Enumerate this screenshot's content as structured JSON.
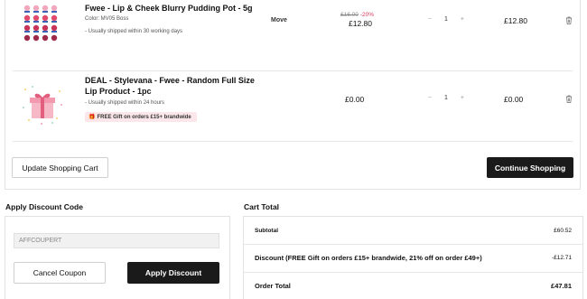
{
  "cart": {
    "items": [
      {
        "name": "Fwee - Lip & Cheek Blurry Pudding Pot - 5g",
        "color_line": "Color: MV05 Boss",
        "shipping": "- Usually shipped within 30 working days",
        "move_label": "Move",
        "price_original": "£16.00",
        "discount_pct": "-20%",
        "price": "£12.80",
        "qty_minus": "−",
        "qty": "1",
        "qty_plus": "+",
        "subtotal": "£12.80",
        "delete_icon": "trash-icon"
      },
      {
        "name": "DEAL - Stylevana - Fwee - Random Full Size Lip Product - 1pc",
        "shipping": "- Usually shipped within 24 hours",
        "gift_badge": "FREE Gift on orders £15+ brandwide",
        "price": "£0.00",
        "qty_minus": "−",
        "qty": "1",
        "qty_plus": "+",
        "subtotal": "£0.00",
        "delete_icon": "trash-icon"
      }
    ],
    "update_button": "Update Shopping Cart",
    "continue_button": "Continue Shopping"
  },
  "discount": {
    "title": "Apply Discount Code",
    "code_value": "AFFCOUPERT",
    "cancel_button": "Cancel Coupon",
    "apply_button": "Apply Discount"
  },
  "cart_total": {
    "title": "Cart Total",
    "subtotal_label": "Subtotal",
    "subtotal_value": "£60.52",
    "discount_label": "Discount (FREE Gift on orders £15+ brandwide, 21% off on order £49+)",
    "discount_value": "-£12.71",
    "order_total_label": "Order Total",
    "order_total_value": "£47.81"
  },
  "colors": {
    "primary_button": "#1a1a1a",
    "discount_red": "#d63a5a",
    "gift_badge_bg": "#fbe7ea"
  }
}
